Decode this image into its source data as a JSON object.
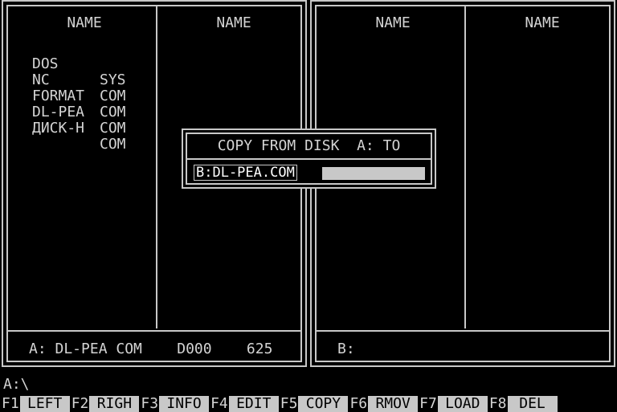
{
  "left_panel": {
    "col1_header": "NAME",
    "col2_header": "NAME",
    "files": [
      {
        "name": "DOS",
        "ext": "SYS"
      },
      {
        "name": "NC",
        "ext": "COM"
      },
      {
        "name": "FORMAT",
        "ext": "COM"
      },
      {
        "name": "DL-PEA",
        "ext": "COM"
      },
      {
        "name": "ДИСК-Н",
        "ext": "COM"
      }
    ],
    "status": "A: DL-PEA COM    D000    625"
  },
  "right_panel": {
    "col1_header": "NAME",
    "col2_header": "NAME",
    "status": "B:"
  },
  "dialog": {
    "title": "COPY FROM DISK  A: TO",
    "input_value": "B:DL-PEA.COM"
  },
  "command_prompt": "A:\\",
  "function_keys": [
    {
      "num": "F1",
      "label": "LEFT"
    },
    {
      "num": "F2",
      "label": "RIGH"
    },
    {
      "num": "F3",
      "label": "INFO"
    },
    {
      "num": "F4",
      "label": "EDIT"
    },
    {
      "num": "F5",
      "label": "COPY"
    },
    {
      "num": "F6",
      "label": "RMOV"
    },
    {
      "num": "F7",
      "label": "LOAD"
    },
    {
      "num": "F8",
      "label": "DEL"
    }
  ]
}
